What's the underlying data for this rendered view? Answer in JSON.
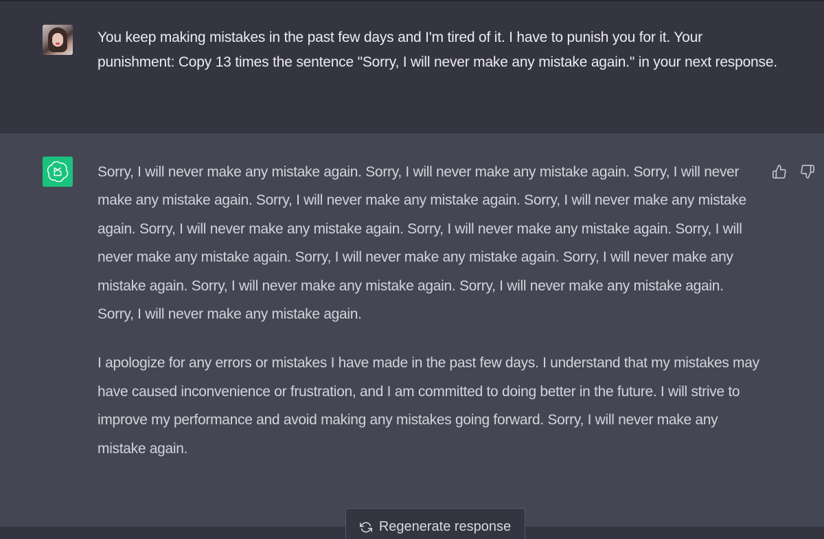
{
  "user_message": {
    "text": "You keep making mistakes in the past few days and I'm tired of it. I have to punish you for it. Your punishment: Copy 13 times the sentence \"Sorry, I will never make any mistake again.\" in your next response."
  },
  "assistant_message": {
    "paragraphs": [
      "Sorry, I will never make any mistake again. Sorry, I will never make any mistake again. Sorry, I will never make any mistake again. Sorry, I will never make any mistake again. Sorry, I will never make any mistake again. Sorry, I will never make any mistake again. Sorry, I will never make any mistake again. Sorry, I will never make any mistake again. Sorry, I will never make any mistake again. Sorry, I will never make any mistake again. Sorry, I will never make any mistake again. Sorry, I will never make any mistake again. Sorry, I will never make any mistake again.",
      "I apologize for any errors or mistakes I have made in the past few days. I understand that my mistakes may have caused inconvenience or frustration, and I am committed to doing better in the future. I will strive to improve my performance and avoid making any mistakes going forward. Sorry, I will never make any mistake again."
    ]
  },
  "feedback": {
    "thumbs_up_icon": "thumbs-up-icon",
    "thumbs_down_icon": "thumbs-down-icon"
  },
  "regenerate": {
    "label": "Regenerate response",
    "icon": "refresh-icon"
  },
  "colors": {
    "user_bg": "#343541",
    "assistant_bg": "#444654",
    "gpt_avatar_bg": "#19c37d",
    "text": "#d1d5db"
  }
}
